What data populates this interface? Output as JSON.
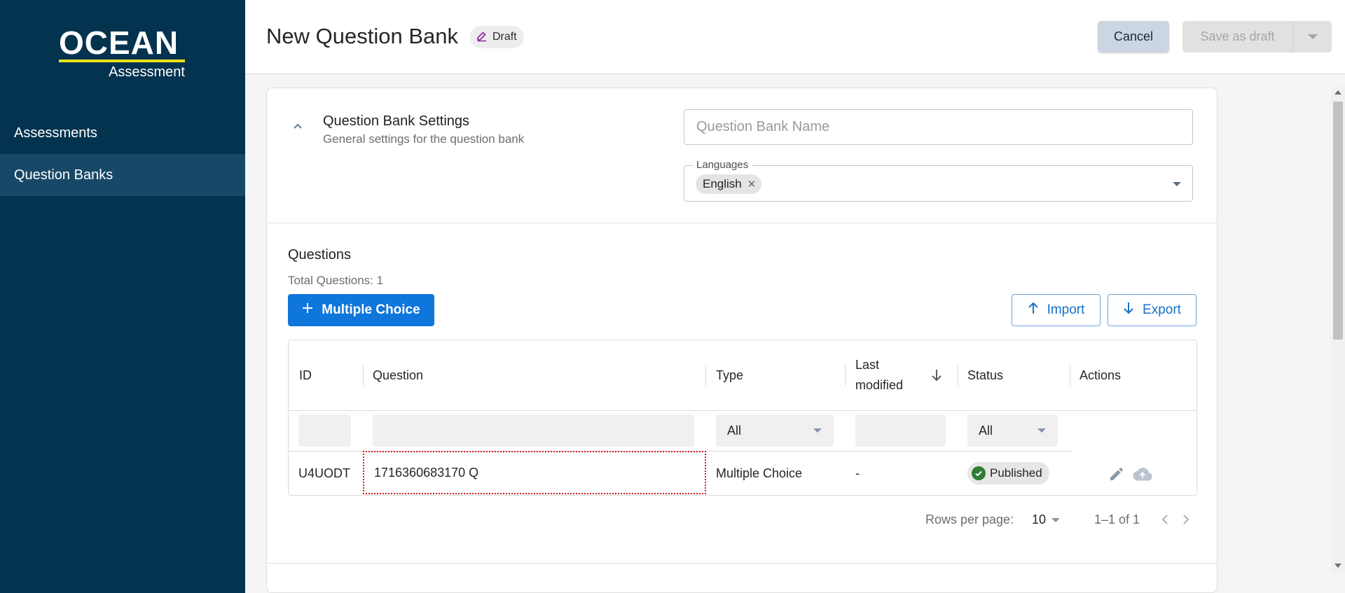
{
  "brand": {
    "name": "OCEAN",
    "tagline": "Assessment"
  },
  "sidebar": {
    "items": [
      {
        "label": "Assessments",
        "active": false
      },
      {
        "label": "Question Banks",
        "active": true
      }
    ]
  },
  "header": {
    "title": "New Question Bank",
    "status_chip": "Draft",
    "cancel_label": "Cancel",
    "save_label": "Save as draft",
    "save_disabled": true
  },
  "settings": {
    "title": "Question Bank Settings",
    "subtitle": "General settings for the question bank",
    "name_value": "",
    "name_placeholder": "Question Bank Name",
    "languages_label": "Languages",
    "languages": [
      "English"
    ],
    "expanded": true
  },
  "questions": {
    "title": "Questions",
    "total_label": "Total Questions: 1",
    "add_button_label": "Multiple Choice",
    "import_label": "Import",
    "export_label": "Export",
    "table": {
      "columns": [
        "ID",
        "Question",
        "Type",
        "Last modified",
        "Status",
        "Actions"
      ],
      "sorted_column": "Last modified",
      "sort_direction": "desc",
      "filters": {
        "id": "",
        "question": "",
        "type": "All",
        "last_modified": "",
        "status": "All"
      },
      "rows": [
        {
          "id": "U4UODT",
          "question": "1716360683170 Q",
          "type": "Multiple Choice",
          "last_modified": "-",
          "status": "Published"
        }
      ]
    },
    "pagination": {
      "rows_per_page_label": "Rows per page:",
      "rows_per_page": "10",
      "range": "1–1 of 1"
    }
  },
  "colors": {
    "sidebar_bg": "#04334f",
    "sidebar_active": "#174868",
    "logo_accent": "#e8e11a",
    "primary": "#0f76dc",
    "published": "#2e7d32",
    "focus_outline": "#d31c1c"
  },
  "icons": {
    "draft": "pencil-edit-icon",
    "collapse": "chevron-up-icon",
    "add": "plus-icon",
    "import": "arrow-up-icon",
    "export": "arrow-down-icon",
    "sort": "arrow-down-icon",
    "status": "check-circle-icon",
    "edit": "pencil-icon",
    "publish": "cloud-upload-icon",
    "prev": "chevron-left-icon",
    "next": "chevron-right-icon"
  }
}
